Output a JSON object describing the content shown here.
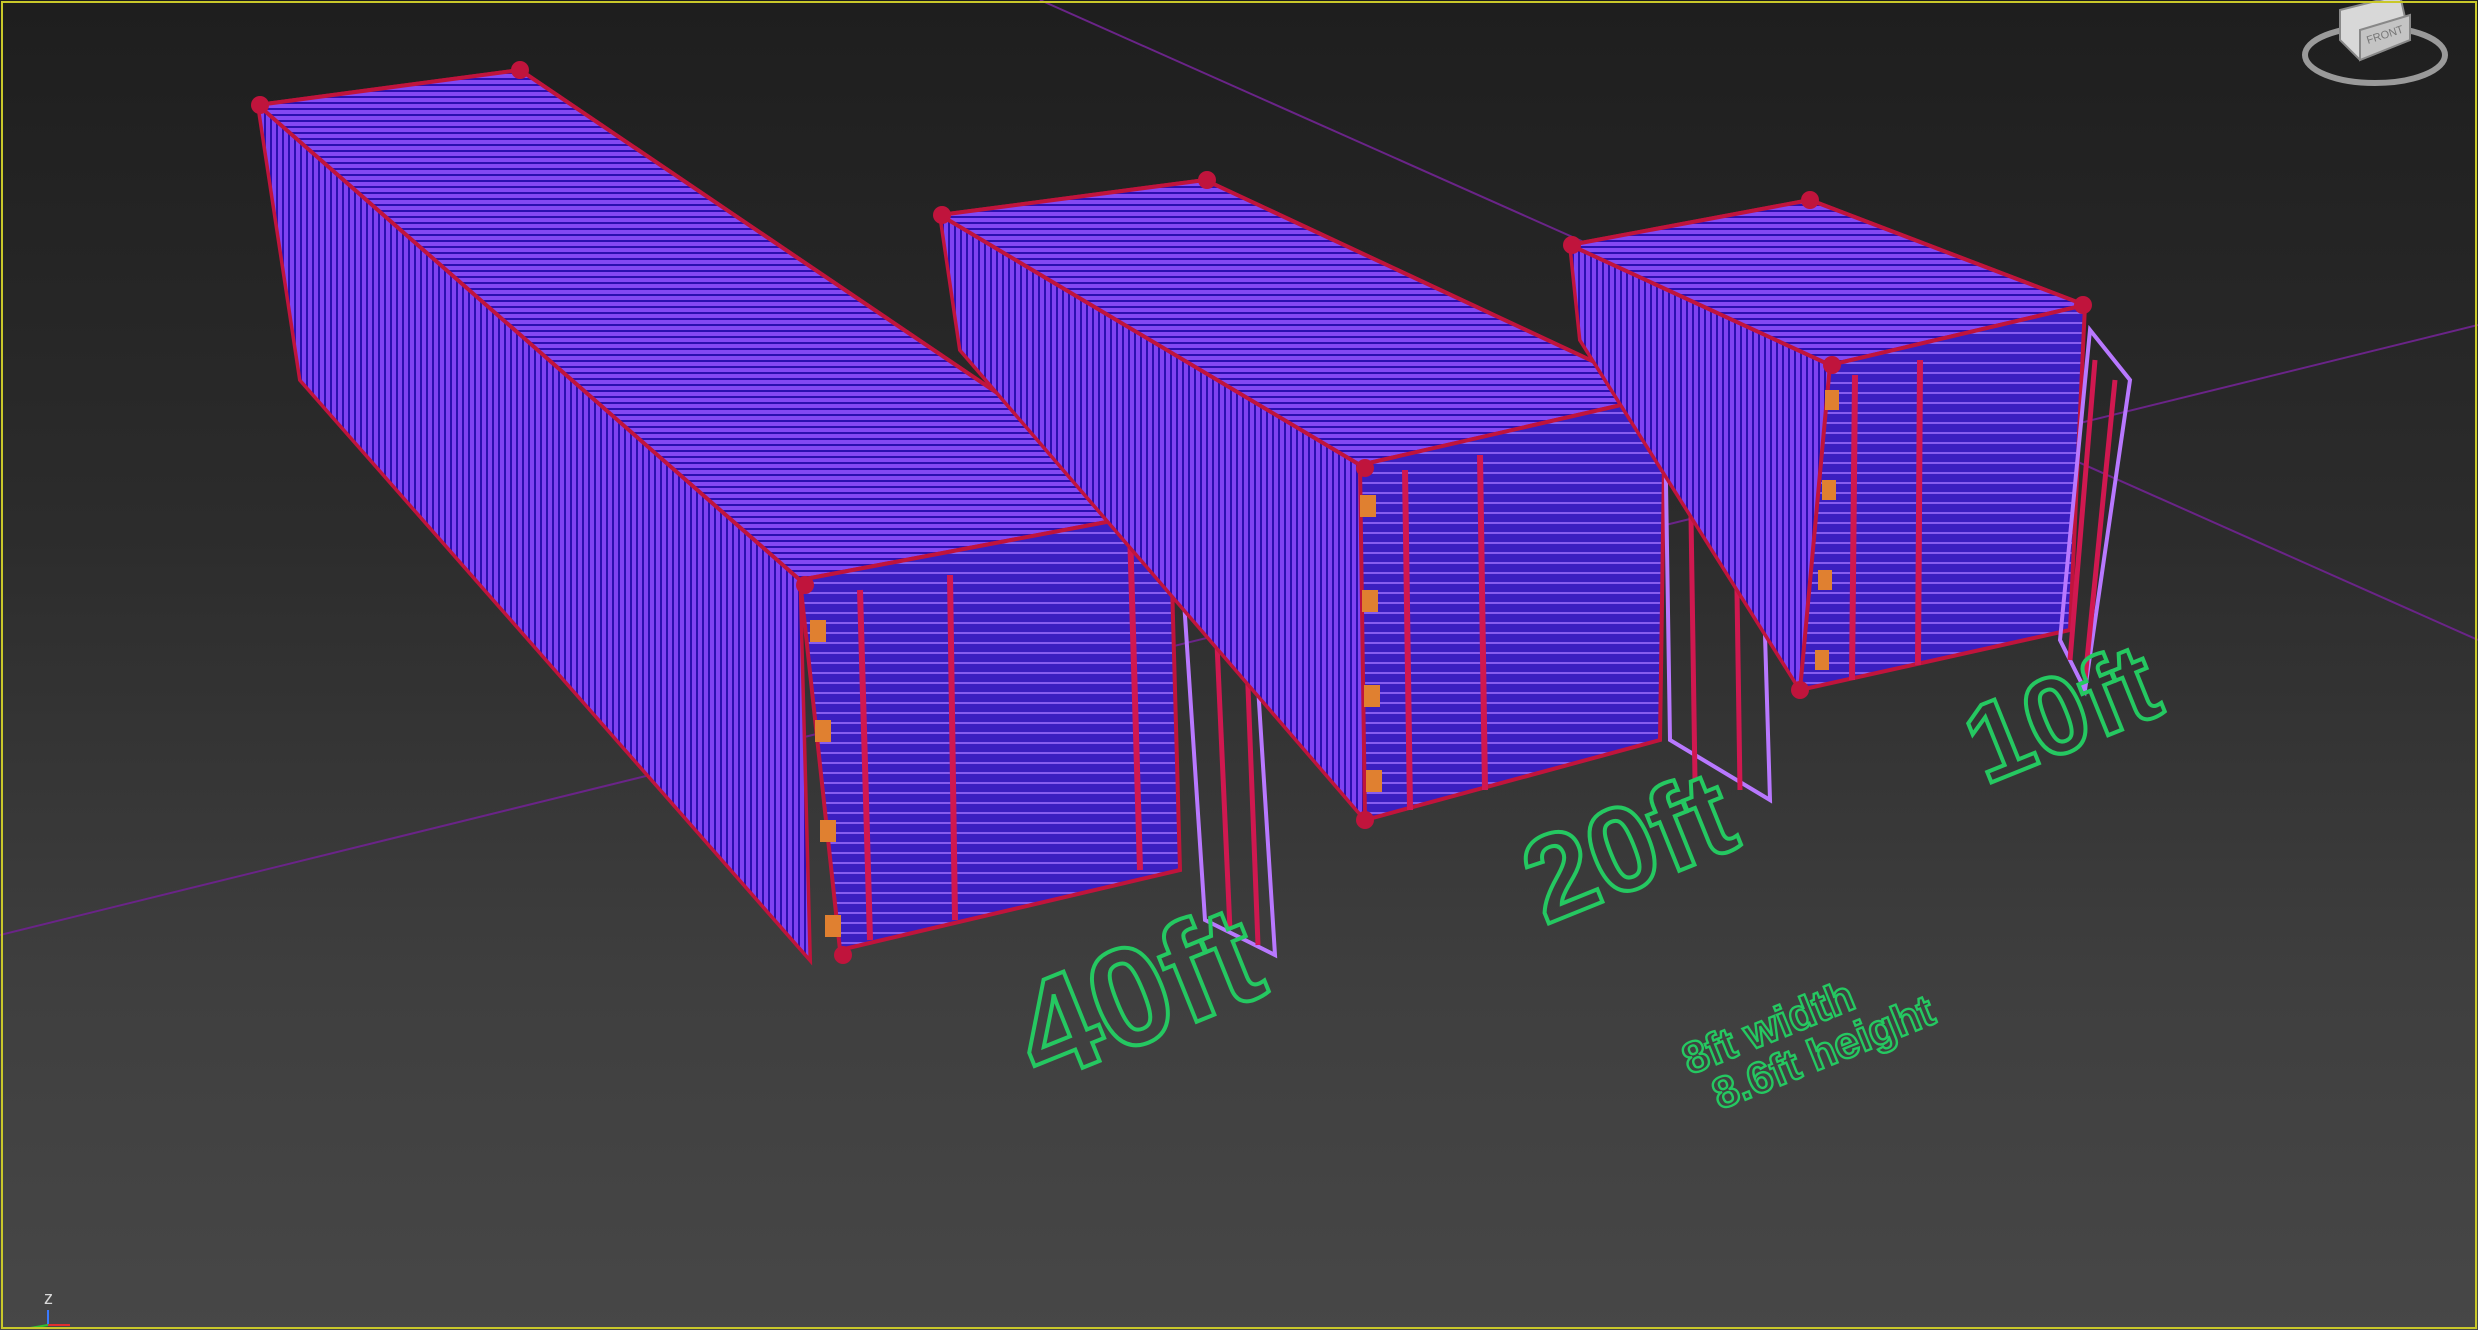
{
  "scene": {
    "labels": {
      "container_large": "40ft",
      "container_medium": "20ft",
      "container_small": "10ft",
      "dimensions_width": "8ft width",
      "dimensions_height": "8.6ft height"
    },
    "axis_tripod": {
      "z_label": "z"
    },
    "viewcube": {
      "face_label": "FRONT"
    }
  },
  "colors": {
    "viewport_border": "#c9c82a",
    "wire_body": "#7a3cf0",
    "wire_lines": "#2a0da8",
    "frame_red": "#c0143c",
    "label_green": "#25c861",
    "grid_line": "#7a2a9a"
  }
}
